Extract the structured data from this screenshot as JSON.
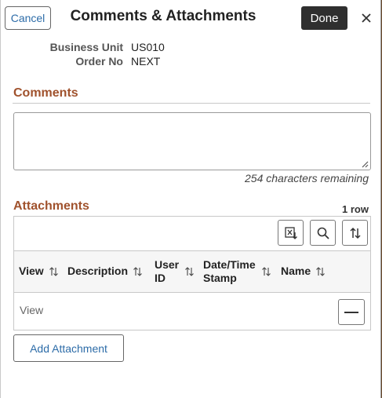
{
  "header": {
    "cancel_label": "Cancel",
    "title": "Comments & Attachments",
    "done_label": "Done",
    "close_icon": "close-icon"
  },
  "fields": {
    "business_unit_label": "Business Unit",
    "business_unit_value": "US010",
    "order_no_label": "Order No",
    "order_no_value": "NEXT"
  },
  "comments": {
    "section_title": "Comments",
    "value": "",
    "chars_remaining": "254 characters remaining"
  },
  "attachments": {
    "section_title": "Attachments",
    "row_count": "1 row",
    "toolbar": [
      "export-excel-icon",
      "search-icon",
      "sort-icon"
    ],
    "columns": [
      "View",
      "Description",
      "User ID",
      "Date/Time Stamp",
      "Name"
    ],
    "rows": [
      {
        "view": "View",
        "description": "",
        "user_id": "",
        "timestamp": "",
        "name": ""
      }
    ],
    "add_label": "Add Attachment"
  },
  "colors": {
    "section_title": "#a0522d",
    "link_blue": "#2d6ca8",
    "done_bg": "#2f2f2f"
  }
}
